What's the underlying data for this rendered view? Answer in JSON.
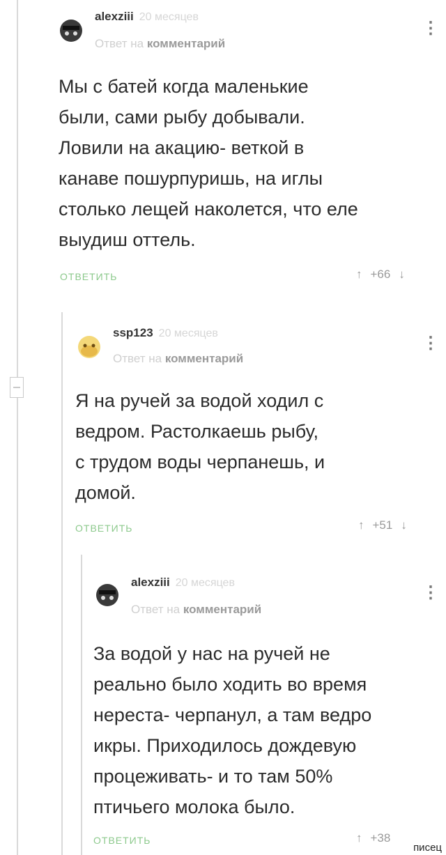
{
  "comments": [
    {
      "username": "alexziii",
      "time": "20 месяцев",
      "reply_prefix": "Ответ на",
      "reply_target": "комментарий",
      "menu": "⋮",
      "lines": [
        "Мы с батей когда маленькие",
        "были, сами рыбу добывали.",
        "Ловили на акацию- веткой в",
        "канаве пошурпуришь, на иглы",
        "столько лещей наколется, что еле",
        "выудиш оттель."
      ],
      "reply_label": "ОТВЕТИТЬ",
      "rating": "+66"
    },
    {
      "username": "ssp123",
      "time": "20 месяцев",
      "reply_prefix": "Ответ на",
      "reply_target": "комментарий",
      "menu": "⋮",
      "lines": [
        "Я на ручей за водой ходил с",
        "ведром. Растолкаешь рыбу,",
        "с трудом воды черпанешь, и",
        "домой."
      ],
      "reply_label": "ОТВЕТИТЬ",
      "rating": "+51"
    },
    {
      "username": "alexziii",
      "time": "20 месяцев",
      "reply_prefix": "Ответ на",
      "reply_target": "комментарий",
      "menu": "⋮",
      "lines": [
        "За водой у нас на ручей не",
        "реально было ходить во время",
        "нереста- черпанул, а там ведро",
        "икры. Приходилось дождевую",
        "процеживать- и то там 50%",
        "птичьего молока было."
      ],
      "reply_label": "ОТВЕТИТЬ",
      "rating": "+38"
    }
  ],
  "icons": {
    "up": "arrow-up-icon",
    "down": "arrow-down-icon"
  },
  "watermark": "писец",
  "colors": {
    "accent": "#8cc98c",
    "muted": "#d0d0d0"
  }
}
